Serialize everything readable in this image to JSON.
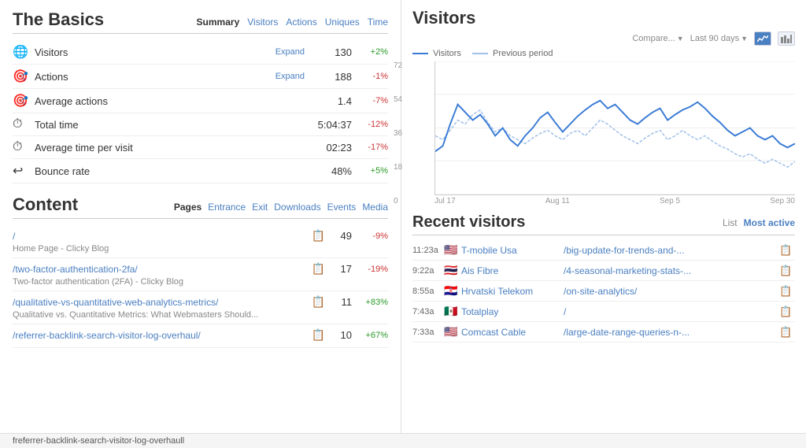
{
  "basics": {
    "title": "The Basics",
    "tabs": [
      {
        "label": "Summary",
        "active": true
      },
      {
        "label": "Visitors",
        "active": false
      },
      {
        "label": "Actions",
        "active": false
      },
      {
        "label": "Uniques",
        "active": false
      },
      {
        "label": "Time",
        "active": false
      }
    ],
    "metrics": [
      {
        "icon": "🌐",
        "label": "Visitors",
        "expandable": true,
        "value": "130",
        "change": "+2%",
        "positive": true
      },
      {
        "icon": "🎯",
        "label": "Actions",
        "expandable": true,
        "value": "188",
        "change": "-1%",
        "positive": false
      },
      {
        "icon": "🎯",
        "label": "Average actions",
        "expandable": false,
        "value": "1.4",
        "change": "-7%",
        "positive": false
      },
      {
        "icon": "⏱",
        "label": "Total time",
        "expandable": false,
        "value": "5:04:37",
        "change": "-12%",
        "positive": false
      },
      {
        "icon": "⏱",
        "label": "Average time per visit",
        "expandable": false,
        "value": "02:23",
        "change": "-17%",
        "positive": false
      },
      {
        "icon": "↩",
        "label": "Bounce rate",
        "expandable": false,
        "value": "48%",
        "change": "+5%",
        "positive": true
      }
    ]
  },
  "content": {
    "title": "Content",
    "tabs": [
      {
        "label": "Pages",
        "active": true
      },
      {
        "label": "Entrance",
        "active": false
      },
      {
        "label": "Exit",
        "active": false
      },
      {
        "label": "Downloads",
        "active": false
      },
      {
        "label": "Events",
        "active": false
      },
      {
        "label": "Media",
        "active": false
      }
    ],
    "items": [
      {
        "path": "/",
        "sub": "Home Page - Clicky Blog",
        "count": "49",
        "change": "-9%",
        "positive": false
      },
      {
        "path": "/two-factor-authentication-2fa/",
        "sub": "Two-factor authentication (2FA) - Clicky Blog",
        "count": "17",
        "change": "-19%",
        "positive": false
      },
      {
        "path": "/qualitative-vs-quantitative-web-analytics-metrics/",
        "sub": "Qualitative vs. Quantitative Metrics: What Webmasters Should...",
        "count": "11",
        "change": "+83%",
        "positive": true
      },
      {
        "path": "/referrer-backlink-search-visitor-log-overhaul/",
        "sub": "",
        "count": "10",
        "change": "+67%",
        "positive": true
      }
    ]
  },
  "visitors_chart": {
    "title": "Visitors",
    "compare_label": "Compare...",
    "period_label": "Last 90 days",
    "legend": {
      "visitors_label": "Visitors",
      "previous_label": "Previous period"
    },
    "x_labels": [
      "Jul 17",
      "Aug 11",
      "Sep 5",
      "Sep 30"
    ],
    "y_labels": [
      "72",
      "54",
      "36",
      "18",
      "0"
    ]
  },
  "recent_visitors": {
    "title": "Recent visitors",
    "tabs": [
      {
        "label": "List",
        "active": false
      },
      {
        "label": "Most active",
        "active": true
      }
    ],
    "visitors": [
      {
        "time": "11:23a",
        "flag": "🇺🇸",
        "isp": "T-mobile Usa",
        "path": "/big-update-for-trends-and-..."
      },
      {
        "time": "9:22a",
        "flag": "🇹🇭",
        "isp": "Ais Fibre",
        "path": "/4-seasonal-marketing-stats-..."
      },
      {
        "time": "8:55a",
        "flag": "🇭🇷",
        "isp": "Hrvatski Telekom",
        "path": "/on-site-analytics/"
      },
      {
        "time": "7:43a",
        "flag": "🇲🇽",
        "isp": "Totalplay",
        "path": "/"
      },
      {
        "time": "7:33a",
        "flag": "🇺🇸",
        "isp": "Comcast Cable",
        "path": "/large-date-range-queries-n-..."
      }
    ]
  },
  "footer": {
    "text": "freferrer-backlink-search-visitor-log-overhaull"
  }
}
